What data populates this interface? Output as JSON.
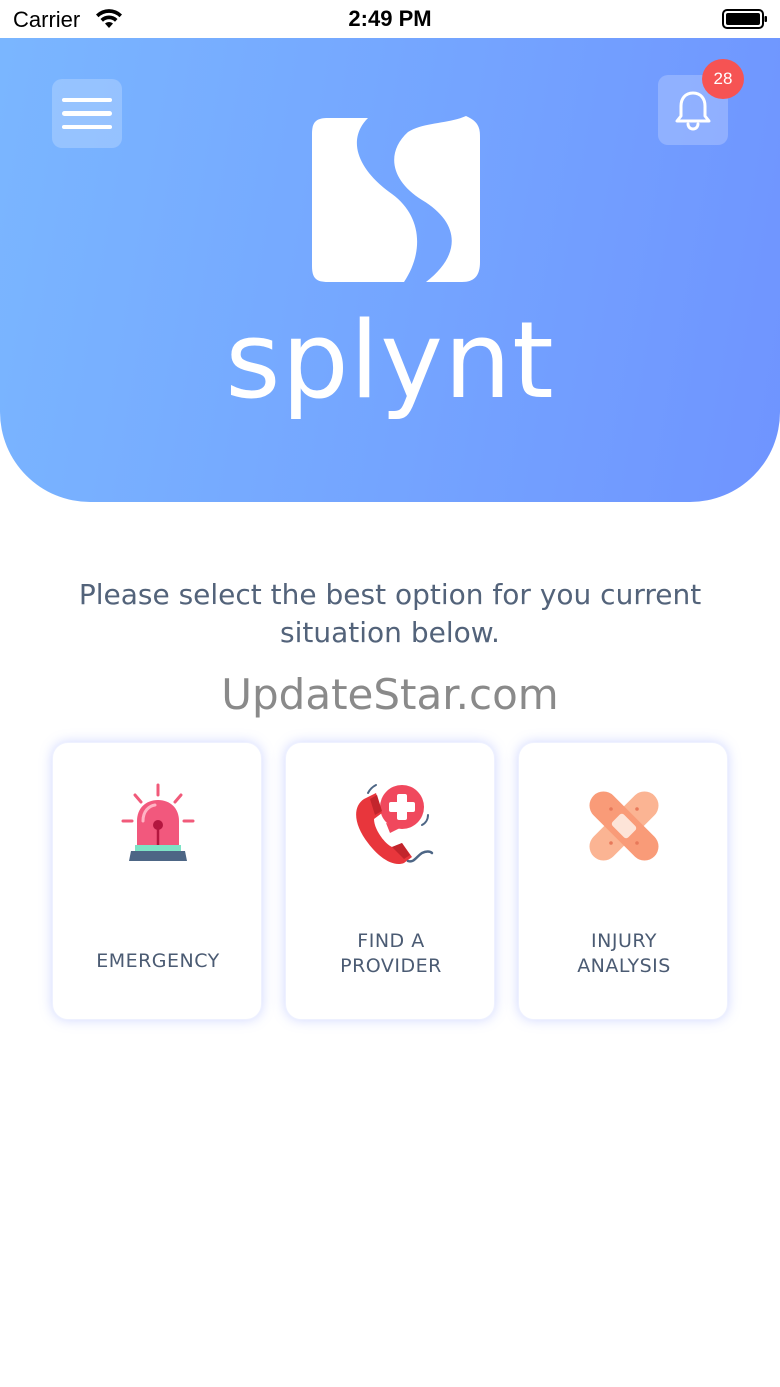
{
  "status_bar": {
    "carrier": "Carrier",
    "time": "2:49 PM",
    "wifi_icon": "wifi-icon",
    "battery_icon": "battery-icon"
  },
  "header": {
    "menu_icon": "hamburger-menu-icon",
    "bell_icon": "bell-icon",
    "notification_count": "28",
    "logo_text": "splynt",
    "gradient_start": "#7ab6ff",
    "gradient_end": "#6f94ff"
  },
  "main": {
    "prompt": "Please select the best option for you current situation below.",
    "watermark": "UpdateStar.com",
    "options": [
      {
        "label_line1": "EMERGENCY",
        "label_line2": "",
        "icon": "siren-icon"
      },
      {
        "label_line1": "FIND A",
        "label_line2": "PROVIDER",
        "icon": "medical-phone-icon"
      },
      {
        "label_line1": "INJURY",
        "label_line2": "ANALYSIS",
        "icon": "bandage-icon"
      }
    ]
  },
  "colors": {
    "badge": "#f65353",
    "text": "#53637a",
    "card_shadow": "#788cff"
  }
}
